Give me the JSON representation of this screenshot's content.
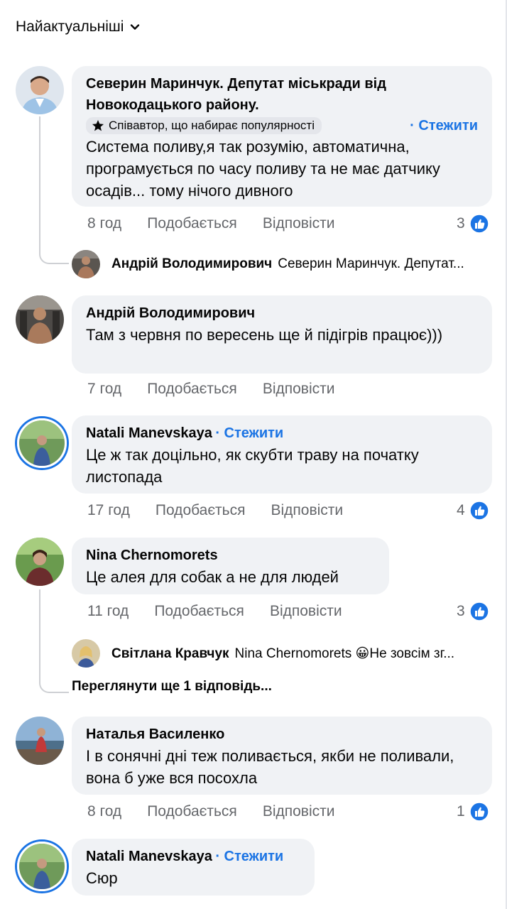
{
  "sort": {
    "label": "Найактуальніші"
  },
  "comments": [
    {
      "name": "Северин Маринчук. Депутат міськради від Новокодацького району.",
      "badge": "Співавтор, що набирає популярності",
      "follow": "· Стежити",
      "text": "Система поливу,я так розумію, автоматична, програмується по часу поливу та не має датчику осадів... тому нічого дивного",
      "time": "8 год",
      "like": "Подобається",
      "reply": "Відповісти",
      "reactions": "3",
      "reply_preview": {
        "name": "Андрій Володимирович",
        "text": "Северин Маринчук. Депутат..."
      }
    },
    {
      "name": "Андрій Володимирович",
      "text": "Там з червня по вересень ще й підігрів працює)))",
      "time": "7 год",
      "like": "Подобається",
      "reply": "Відповісти"
    },
    {
      "name": "Natali Manevskaya",
      "follow": "· Стежити",
      "text": "Це ж так доцільно, як скубти траву на початку листопада",
      "time": "17 год",
      "like": "Подобається",
      "reply": "Відповісти",
      "reactions": "4"
    },
    {
      "name": "Nina  Chernomorets",
      "text": "Це алея для собак а не для людей",
      "time": "11 год",
      "like": "Подобається",
      "reply": "Відповісти",
      "reactions": "3",
      "reply_preview": {
        "name": "Світлана Кравчук",
        "text": "Nina  Chernomorets 😀Не зовсім зг..."
      },
      "more_replies": "Переглянути ще 1 відповідь..."
    },
    {
      "name": "Наталья Василенко",
      "text": "І в сонячні дні теж поливається, якби не поливали, вона б уже вся посохла",
      "time": "8 год",
      "like": "Подобається",
      "reply": "Відповісти",
      "reactions": "1"
    },
    {
      "name": "Natali Manevskaya",
      "follow": "· Стежити",
      "text": "Сюр"
    }
  ],
  "colors": {
    "accent": "#1b74e4",
    "bubble": "#f0f2f5",
    "meta": "#65676b"
  }
}
